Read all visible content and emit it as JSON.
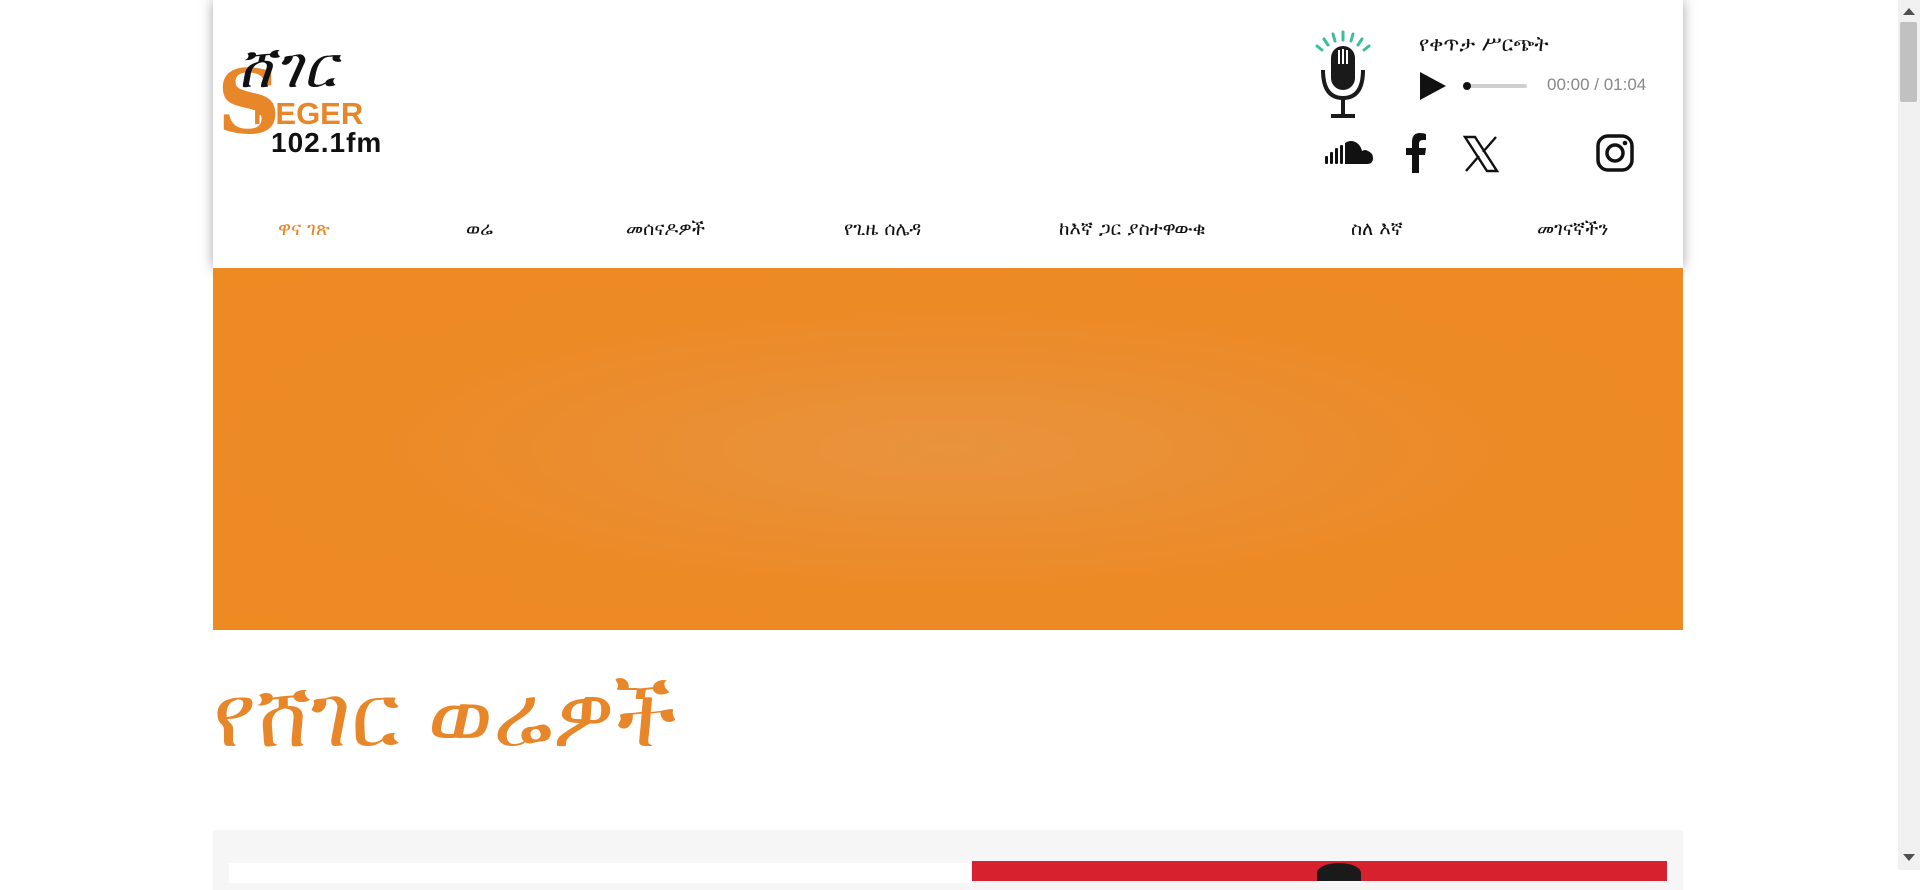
{
  "brand": {
    "logo_amharic": "ሸገር",
    "logo_s": "S",
    "logo_heger": "HEGER",
    "logo_freq": "102.1fm"
  },
  "player": {
    "title": "የቀጥታ ሥርጭት",
    "time": "00:00 / 01:04",
    "progress": 0.05,
    "mic_icon": "microphone-icon",
    "play_icon": "play-icon"
  },
  "social": [
    {
      "name": "soundcloud",
      "icon": "soundcloud-icon"
    },
    {
      "name": "facebook",
      "icon": "facebook-icon"
    },
    {
      "name": "x",
      "icon": "x-twitter-icon"
    },
    {
      "name": "instagram",
      "icon": "instagram-icon"
    }
  ],
  "nav": {
    "items": [
      {
        "label": "ዋና ገጽ",
        "active": true
      },
      {
        "label": "ወሬ",
        "active": false
      },
      {
        "label": "መሰናዶዎች",
        "active": false
      },
      {
        "label": "የጊዜ ሰሌዳ",
        "active": false
      },
      {
        "label": "ከእኛ ጋር ያስተዋውቁ",
        "active": false
      },
      {
        "label": "ስለ እኛ",
        "active": false
      },
      {
        "label": "መገናኛችን",
        "active": false
      }
    ]
  },
  "main": {
    "section_title": "የሸገር ወሬዎች"
  },
  "colors": {
    "accent": "#e8862a",
    "banner": "#ec8a26",
    "card_image": "#d7212f"
  }
}
